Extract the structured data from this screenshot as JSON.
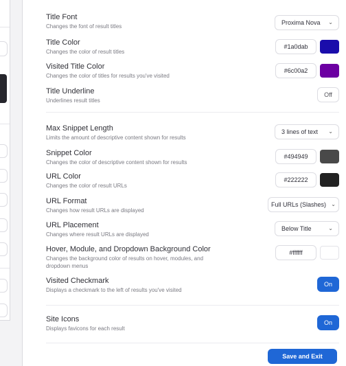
{
  "settings": {
    "title_font": {
      "label": "Title Font",
      "desc": "Changes the font of result titles",
      "value": "Proxima Nova"
    },
    "title_color": {
      "label": "Title Color",
      "desc": "Changes the color of result titles",
      "value": "#1a0dab",
      "swatch": "#1a0dab"
    },
    "visited_title_color": {
      "label": "Visited Title Color",
      "desc": "Changes the color of titles for results you've visited",
      "value": "#6c00a2",
      "swatch": "#6c00a2"
    },
    "title_underline": {
      "label": "Title Underline",
      "desc": "Underlines result titles",
      "state": "Off"
    },
    "max_snippet_length": {
      "label": "Max Snippet Length",
      "desc": "Limits the amount of descriptive content shown for results",
      "value": "3 lines of text"
    },
    "snippet_color": {
      "label": "Snippet Color",
      "desc": "Changes the color of descriptive content shown for results",
      "value": "#494949",
      "swatch": "#494949"
    },
    "url_color": {
      "label": "URL Color",
      "desc": "Changes the color of result URLs",
      "value": "#222222",
      "swatch": "#222222"
    },
    "url_format": {
      "label": "URL Format",
      "desc": "Changes how result URLs are displayed",
      "value": "Full URLs (Slashes)"
    },
    "url_placement": {
      "label": "URL Placement",
      "desc": "Changes where result URLs are displayed",
      "value": "Below Title"
    },
    "hover_bg_color": {
      "label": "Hover, Module, and Dropdown Background Color",
      "desc": "Changes the background color of results on hover, modules, and dropdown menus",
      "value": "#ffffff",
      "swatch": "#ffffff"
    },
    "visited_checkmark": {
      "label": "Visited Checkmark",
      "desc": "Displays a checkmark to the left of results you've visited",
      "state": "On"
    },
    "site_icons": {
      "label": "Site Icons",
      "desc": "Displays favicons for each result",
      "state": "On"
    }
  },
  "footer": {
    "save_label": "Save and Exit"
  },
  "colors": {
    "accent": "#1f67d6"
  }
}
